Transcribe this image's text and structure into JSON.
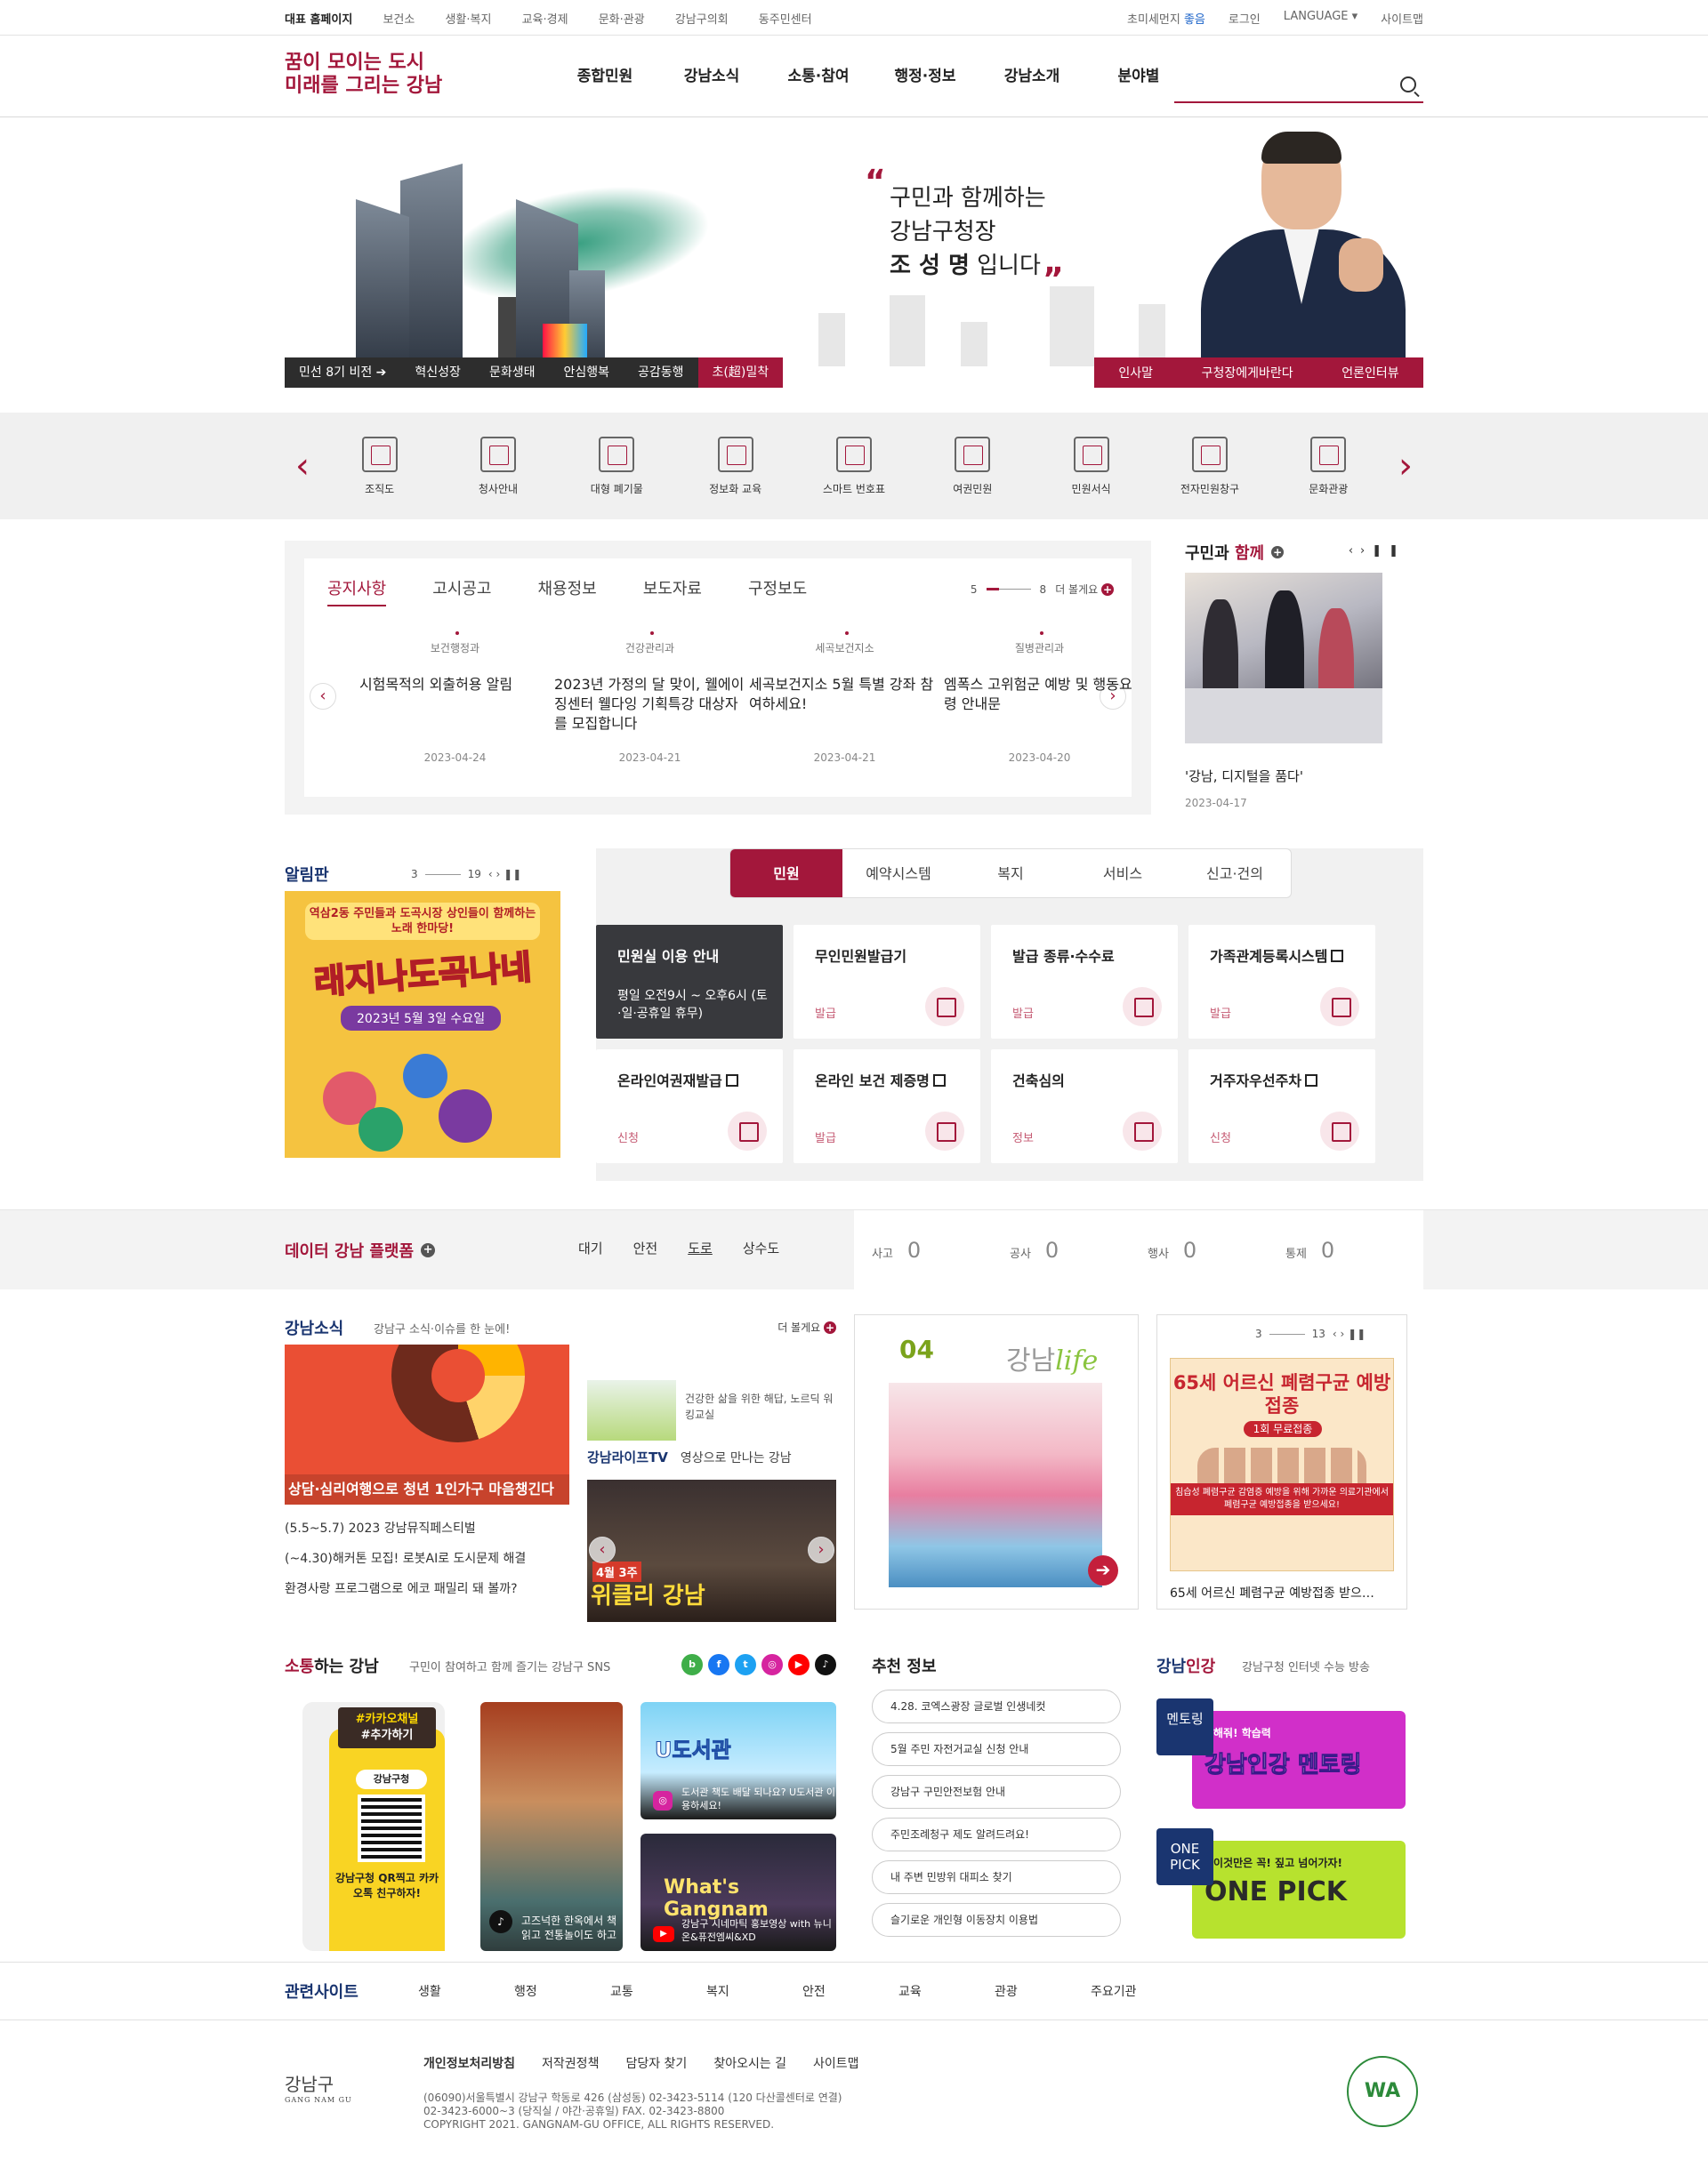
{
  "util": {
    "left": [
      "대표 홈페이지",
      "보건소",
      "생활·복지",
      "교육·경제",
      "문화·관광",
      "강남구의회",
      "동주민센터"
    ],
    "fine_dust_label": "초미세먼지",
    "fine_dust_value": "좋음",
    "login": "로그인",
    "language": "LANGUAGE",
    "sitemap": "사이트맵"
  },
  "header": {
    "logo_line1": "꿈이 모이는 도시",
    "logo_line2": "미래를 그리는 강남",
    "menu": [
      "종합민원",
      "강남소식",
      "소통·참여",
      "행정·정보",
      "강남소개",
      "분야별"
    ],
    "search_placeholder": ""
  },
  "hero": {
    "left_links": [
      "민선 8기 비전",
      "혁신성장",
      "문화생태",
      "안심행복",
      "공감동행",
      "초(超)밀착"
    ],
    "quote_line1": "구민과 함께하는",
    "quote_line2": "강남구청장",
    "quote_name": "조 성 명",
    "quote_suffix": "입니다",
    "right_links": [
      "인사말",
      "구청장에게바란다",
      "언론인터뷰"
    ]
  },
  "quick": {
    "items": [
      "조직도",
      "청사안내",
      "대형 폐기물",
      "정보화 교육",
      "스마트 번호표",
      "여권민원",
      "민원서식",
      "전자민원창구",
      "문화관광"
    ]
  },
  "notice": {
    "tabs": [
      "공지사항",
      "고시공고",
      "채용정보",
      "보도자료",
      "구정보도"
    ],
    "pager_current": "5",
    "pager_total": "8",
    "more": "더 볼게요",
    "cards": [
      {
        "cat": "보건행정과",
        "title": "시험목적의 외출허용 알림",
        "date": "2023-04-24"
      },
      {
        "cat": "건강관리과",
        "title": "2023년 가정의 달 맞이, 웰에이징센터 웰다잉 기획특강 대상자를 모집합니다",
        "date": "2023-04-21"
      },
      {
        "cat": "세곡보건지소",
        "title": "세곡보건지소 5월 특별 강좌 참여하세요!",
        "date": "2023-04-21"
      },
      {
        "cat": "질병관리과",
        "title": "엠폭스 고위험군 예방 및 행동요령 안내문",
        "date": "2023-04-20"
      }
    ]
  },
  "together": {
    "title_a": "구민과",
    "title_b": "함께",
    "caption": "'강남, 디지털을 품다'",
    "date": "2023-04-17"
  },
  "board": {
    "title": "알림판",
    "pager_current": "3",
    "pager_total": "19",
    "poster_line1": "역삼2동 주민들과 도곡시장 상인들이 함께하는 노래 한마당!",
    "poster_line2": "래지나도곡나네",
    "poster_line3": "2023년 5월 3일 수요일"
  },
  "service": {
    "tabs": [
      "민원",
      "예약시스템",
      "복지",
      "서비스",
      "신고·건의"
    ],
    "cards": [
      {
        "name": "민원실 이용 안내",
        "sub": "평일 오전9시 ~ 오후6시 (토·일·공휴일 휴무)"
      },
      {
        "name": "무인민원발급기",
        "sub": "발급"
      },
      {
        "name": "발급 종류·수수료",
        "sub": "발급"
      },
      {
        "name": "가족관계등록시스템",
        "sub": "발급"
      },
      {
        "name": "온라인여권재발급",
        "sub": "신청"
      },
      {
        "name": "온라인 보건 제증명",
        "sub": "발급"
      },
      {
        "name": "건축심의",
        "sub": "정보"
      },
      {
        "name": "거주자우선주차",
        "sub": "신청"
      }
    ]
  },
  "data_platform": {
    "title": "데이터 강남 플랫폼",
    "tabs": [
      "대기",
      "안전",
      "도로",
      "상수도"
    ],
    "stats": [
      {
        "label": "사고",
        "value": "0"
      },
      {
        "label": "공사",
        "value": "0"
      },
      {
        "label": "행사",
        "value": "0"
      },
      {
        "label": "통제",
        "value": "0"
      }
    ]
  },
  "gangnam_news": {
    "title": "강남소식",
    "sub": "강남구 소식·이슈를 한 눈에!",
    "more": "더 볼게요",
    "main_caption": "상담·심리여행으로 청년 1인가구 마음챙긴다",
    "list": [
      "(5.5~5.7) 2023 강남뮤직페스티벌",
      "(~4.30)해커톤 모집! 로봇AI로 도시문제 해결",
      "환경사랑 프로그램으로 에코 패밀리 돼 볼까?"
    ],
    "side_text": "건강한 삶을 위한 해답, 노르딕 워킹교실",
    "tv_title": "강남라이프TV",
    "tv_sub": "영상으로 만나는 강남",
    "tv_tag": "4월 3주",
    "tv_big": "위클리 강남"
  },
  "magazine": {
    "issue": "04",
    "brand_a": "강남",
    "brand_b": "life"
  },
  "popup": {
    "pager_current": "3",
    "pager_total": "13",
    "headline": "65세 어르신 폐렴구균 예방접종",
    "badge": "1회 무료접종",
    "band": "침습성 폐렴구균 감염증 예방을 위해 가까운 의료기관에서 폐렴구균 예방접종을 받으세요!",
    "caption": "65세 어르신 폐렴구균 예방접종 받으…"
  },
  "sns": {
    "title_a": "소통",
    "title_b": "하는 강남",
    "sub": "구민이 참여하고 함께 즐기는 강남구 SNS",
    "icons": [
      {
        "name": "blog-icon",
        "glyph": "b",
        "color": "#3fae49"
      },
      {
        "name": "facebook-icon",
        "glyph": "f",
        "color": "#1877f2"
      },
      {
        "name": "twitter-icon",
        "glyph": "t",
        "color": "#1da1f2"
      },
      {
        "name": "instagram-icon",
        "glyph": "◎",
        "color": "#d6249f"
      },
      {
        "name": "youtube-icon",
        "glyph": "▶",
        "color": "#ff0000"
      },
      {
        "name": "tiktok-icon",
        "glyph": "♪",
        "color": "#111111"
      }
    ],
    "kakao_label_a": "#카카오채널",
    "kakao_label_b": "#추가하기",
    "kakao_channel": "강남구청",
    "kakao_text": "강남구청 QR찍고 카카오톡 친구하자!",
    "card1_text": "고즈넉한 한옥에서 책 읽고 전통놀이도 하고",
    "card2_title": "U도서관",
    "card2_text": "도서관 책도 배달 되나요? U도서관 이용하세요!",
    "card3_title": "What's Gangnam",
    "card3_text": "강남구 시네마틱 홍보영상 with 뉴니온&퓨전엠씨&XD"
  },
  "recommend": {
    "title": "추천 정보",
    "items": [
      "4.28. 코엑스광장 글로벌 인생네컷",
      "5월 주민 자전거교실 신청 안내",
      "강남구 구민안전보험 안내",
      "주민조례청구 제도 알려드려요!",
      "내 주변 민방위 대피소 찾기",
      "슬기로운 개인형 이동장치 이용법"
    ]
  },
  "ingang": {
    "title_a": "강남",
    "title_b": "인강",
    "sub": "강남구청 인터넷 수능 방송",
    "item1_tag": "멘토링",
    "item1_sub": "해줘! 학습력",
    "item1_title": "강남인강 멘토링",
    "item2_tag": "ONE PICK",
    "item2_sub": "이것만은 꼭! 짚고 넘어가자!",
    "item2_title": "ONE PICK"
  },
  "related": {
    "title": "관련사이트",
    "items": [
      "생활",
      "행정",
      "교통",
      "복지",
      "안전",
      "교육",
      "관광",
      "주요기관"
    ]
  },
  "footer": {
    "logo": "강남구",
    "logo_en": "GANG NAM GU",
    "links": [
      "개인정보처리방침",
      "저작권정책",
      "담당자 찾기",
      "찾아오시는 길",
      "사이트맵"
    ],
    "addr1": "(06090)서울특별시 강남구 학동로 426 (삼성동) 02-3423-5114 (120 다산콜센터로 연결)",
    "addr2": "02-3423-6000~3 (당직실 / 야간·공휴일) FAX. 02-3423-8800",
    "copyright": "COPYRIGHT 2021. GANGNAM-GU OFFICE, ALL RIGHTS RESERVED.",
    "wa_mark": "WA"
  }
}
